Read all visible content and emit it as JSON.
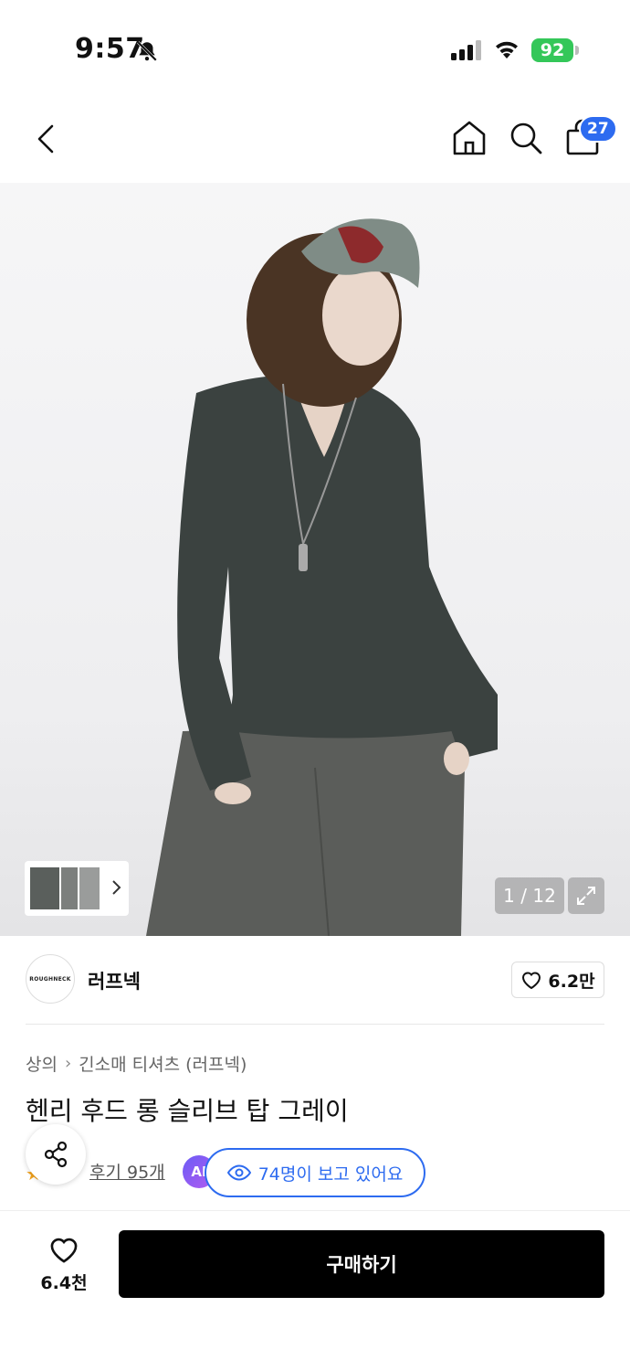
{
  "status_bar": {
    "time": "9:57",
    "battery": "92"
  },
  "nav": {
    "cart_count": "27"
  },
  "gallery": {
    "page_counter": "1 / 12"
  },
  "brand": {
    "logo_text": "ROUGHNECK",
    "name": "러프넥",
    "like_count": "6.2만"
  },
  "breadcrumb": {
    "category": "상의",
    "subcategory": "긴소매 티셔츠 (러프넥)"
  },
  "product": {
    "title": "헨리 후드 롱 슬리브 탑 그레이",
    "review_label": "후기 95개",
    "ai_badge": "AI",
    "viewers_text": "74명이 보고 있어요"
  },
  "bottom_bar": {
    "wish_count": "6.4천",
    "buy_label": "구매하기"
  },
  "colors": {
    "accent_blue": "#2d6bf0",
    "battery_green": "#34c759",
    "buy_button": "#000000",
    "star": "#f3a21b"
  },
  "icons": [
    "bell-muted-icon",
    "signal-icon",
    "wifi-icon",
    "back-icon",
    "home-icon",
    "search-icon",
    "bag-icon",
    "chevron-right-icon",
    "expand-icon",
    "heart-icon",
    "share-icon",
    "star-icon",
    "eye-icon"
  ]
}
